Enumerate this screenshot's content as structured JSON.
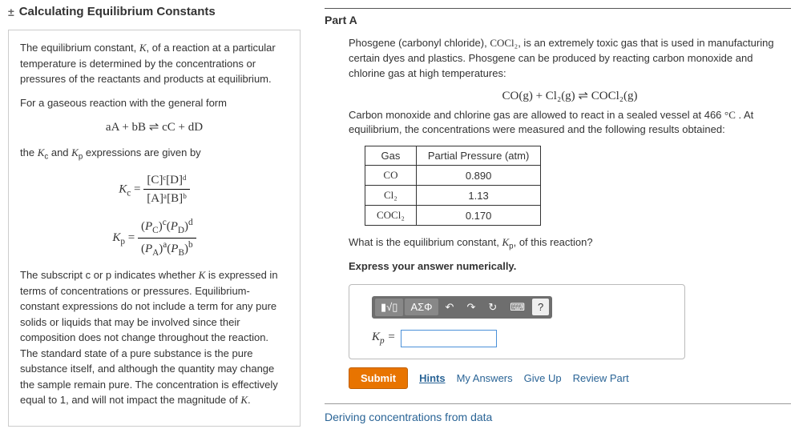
{
  "left": {
    "toggle": "±",
    "title": "Calculating Equilibrium Constants",
    "p1_pre": "The equilibrium constant, ",
    "p1_k": "K",
    "p1_post": ", of a reaction at a particular temperature is determined by the concentrations or pressures of the reactants and products at equilibrium.",
    "p2": "For a gaseous reaction with the general form",
    "eq1": "aA + bB ⇌ cC + dD",
    "p3_pre": "the ",
    "p3_kc": "K",
    "p3_kc_sub": "c",
    "p3_mid": " and ",
    "p3_kp": "K",
    "p3_kp_sub": "p",
    "p3_post": " expressions are given by",
    "kc_label": "K",
    "kc_sub": "c",
    "kc_eq": " = ",
    "kc_num": "[C]ᶜ[D]ᵈ",
    "kc_den": "[A]ᵃ[B]ᵇ",
    "kp_label": "K",
    "kp_sub": "p",
    "kp_eq": " = ",
    "kp_num": "(P_C)ᶜ(P_D)ᵈ",
    "kp_den": "(P_A)ᵃ(P_B)ᵇ",
    "p4_a": "The subscript c or p indicates whether ",
    "p4_k": "K",
    "p4_b": " is expressed in terms of concentrations or pressures. Equilibrium-constant expressions do not include a term for any pure solids or liquids that may be involved since their composition does not change throughout the reaction. The standard state of a pure substance is the pure substance itself, and although the quantity may change the sample remain pure. The concentration is effectively equal to 1, and will not impact the magnitude of ",
    "p4_k2": "K",
    "p4_c": "."
  },
  "right": {
    "part_label": "Part A",
    "intro_a": "Phosgene (carbonyl chloride), ",
    "intro_formula": "COCl₂",
    "intro_b": ", is an extremely toxic gas that is used in manufacturing certain dyes and plastics. Phosgene can be produced by reacting carbon monoxide and chlorine gas at high temperatures:",
    "reaction": "CO(g) + Cl₂(g) ⇌ COCl₂(g)",
    "cond_a": "Carbon monoxide and chlorine gas are allowed to react in a sealed vessel at 466 ",
    "cond_deg": "°C",
    "cond_b": " . At equilibrium, the concentrations were measured and the following results obtained:",
    "table": {
      "h1": "Gas",
      "h2": "Partial Pressure (atm)",
      "rows": [
        {
          "gas": "CO",
          "val": "0.890"
        },
        {
          "gas": "Cl₂",
          "val": "1.13"
        },
        {
          "gas": "COCl₂",
          "val": "0.170"
        }
      ]
    },
    "q_a": "What is the equilibrium constant, ",
    "q_kp": "K",
    "q_kp_sub": "p",
    "q_b": ", of this reaction?",
    "express": "Express your answer numerically.",
    "toolbar": {
      "t1": "▮√▯",
      "t2": "ΑΣΦ",
      "undo": "↶",
      "redo": "↷",
      "reset": "↻",
      "kbd": "⌨",
      "help": "?"
    },
    "ans_label": "K",
    "ans_sub": "p",
    "ans_eq": " = ",
    "submit": "Submit",
    "hints": "Hints",
    "my_answers": "My Answers",
    "give_up": "Give Up",
    "review": "Review Part",
    "next": "Deriving concentrations from data"
  },
  "chart_data": {
    "type": "table",
    "title": "Partial Pressure (atm)",
    "categories": [
      "CO",
      "Cl₂",
      "COCl₂"
    ],
    "values": [
      0.89,
      1.13,
      0.17
    ]
  }
}
